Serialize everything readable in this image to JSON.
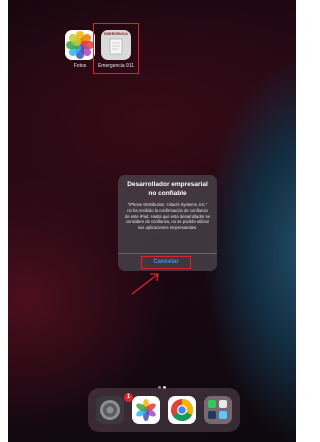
{
  "home": {
    "apps": [
      {
        "label": "Fotos",
        "icon": "photos-icon"
      },
      {
        "label": "Emergencia 911",
        "icon": "emergency-911-icon",
        "tile_text": "EMERGENCIA"
      }
    ],
    "page_dots": 2
  },
  "dialog": {
    "title": "Desarrollador empresarial no confiable",
    "message": "\"iPhone Distribution: Hitachi Systems, Inc.\" no ha recibido la confirmación de confianza de este iPad. Hasta que este desarrollador se considere de confianza, no se podrán utilizar sus aplicaciones empresariales.",
    "cancel_label": "Cancelar"
  },
  "dock": {
    "apps": [
      {
        "icon": "settings-icon",
        "badge": "1"
      },
      {
        "icon": "photos-icon"
      },
      {
        "icon": "chrome-icon"
      },
      {
        "icon": "app-folder-icon"
      }
    ]
  },
  "colors": {
    "highlight": "#e0232a",
    "link_blue": "#4a90e2"
  }
}
